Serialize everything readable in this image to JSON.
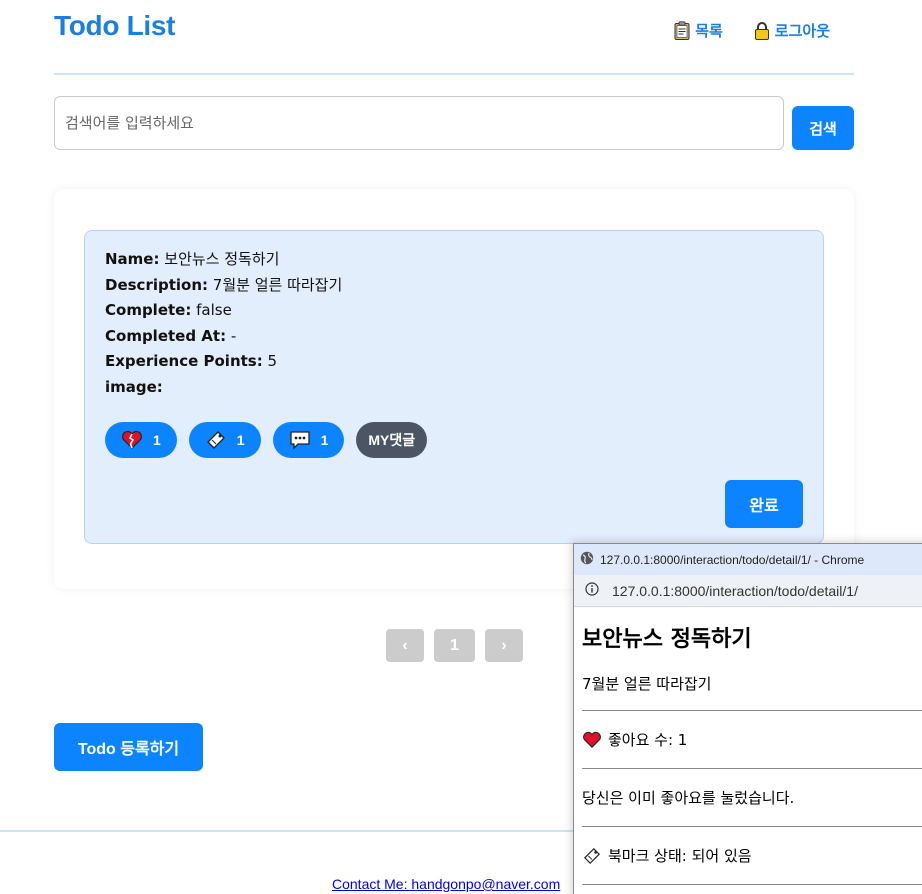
{
  "header": {
    "title": "Todo List",
    "nav": [
      {
        "label": "목록",
        "icon": "clipboard-icon"
      },
      {
        "label": "로그아웃",
        "icon": "lock-icon"
      }
    ]
  },
  "search": {
    "placeholder": "검색어를 입력하세요",
    "value": "",
    "button_label": "검색"
  },
  "todo": {
    "fields": [
      {
        "label": "Name:",
        "value": "보안뉴스 정독하기"
      },
      {
        "label": "Description:",
        "value": "7월분 얼른 따라잡기"
      },
      {
        "label": "Complete:",
        "value": "false"
      },
      {
        "label": "Completed At:",
        "value": "-"
      },
      {
        "label": "Experience Points:",
        "value": "5"
      },
      {
        "label": "image:",
        "value": ""
      }
    ],
    "chips": [
      {
        "icon": "broken-heart-icon",
        "count": "1"
      },
      {
        "icon": "bookmark-icon",
        "count": "1"
      },
      {
        "icon": "comment-icon",
        "count": "1"
      }
    ],
    "my_comments_label": "MY댓글",
    "complete_label": "완료"
  },
  "pagination": {
    "prev": "‹",
    "current": "1",
    "next": "›"
  },
  "register_label": "Todo 등록하기",
  "footer": {
    "contact": "Contact Me: handgonpo@naver.com"
  },
  "popup": {
    "window_title": "127.0.0.1:8000/interaction/todo/detail/1/ - Chrome",
    "url": "127.0.0.1:8000/interaction/todo/detail/1/",
    "heading": "보안뉴스 정독하기",
    "description": "7월분 얼른 따라잡기",
    "likes_text": "좋아요 수: 1",
    "liked_message": "당신은 이미 좋아요를 눌렀습니다.",
    "bookmark_text": "북마크 상태: 되어 있음"
  },
  "colors": {
    "accent": "#0d84ff",
    "title": "#1a7fe0",
    "card_bg": "#e3eefc",
    "dark_chip": "#4b5563",
    "disabled": "#cccccc"
  }
}
